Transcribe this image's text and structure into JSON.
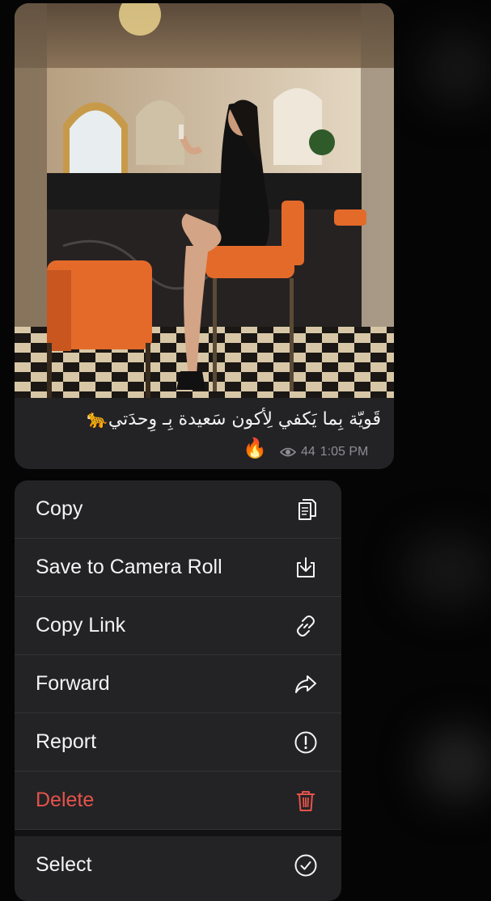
{
  "message": {
    "caption": "قَويّة بِما يَكفي لِأكون سَعيدة بِـ وِحدَتي🐆",
    "reaction": "🔥",
    "views": "44",
    "time": "1:05 PM"
  },
  "icons": {
    "views": "eye-icon",
    "copy": "copy-icon",
    "save": "download-icon",
    "link": "link-icon",
    "forward": "forward-arrow-icon",
    "report": "exclamation-circle-icon",
    "delete": "trash-icon",
    "select": "checkmark-circle-icon"
  },
  "colors": {
    "danger": "#e5534b",
    "bubble": "#232325"
  },
  "menu": {
    "copy": "Copy",
    "save": "Save to Camera Roll",
    "copy_link": "Copy Link",
    "forward": "Forward",
    "report": "Report",
    "delete": "Delete",
    "select": "Select"
  }
}
